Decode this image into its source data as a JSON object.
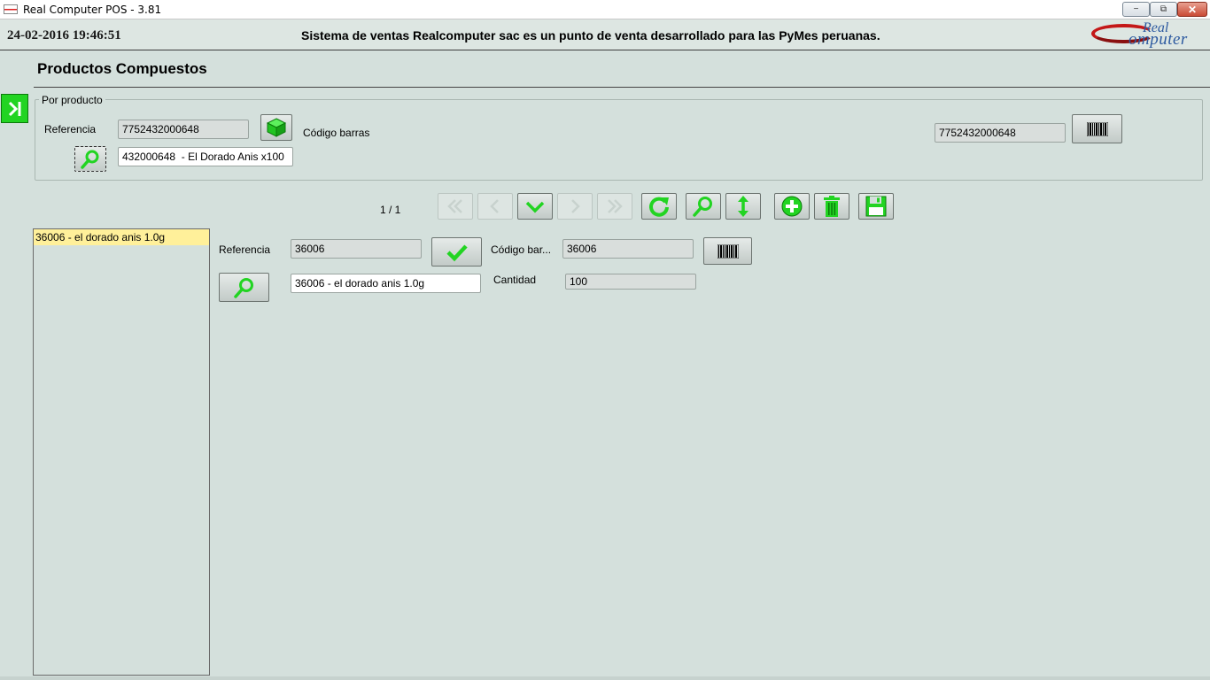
{
  "window": {
    "title": "Real Computer POS - 3.81",
    "minimize": "−",
    "maximize": "⧉",
    "close": "✕"
  },
  "header": {
    "datetime": "24-02-2016 19:46:51",
    "tagline": "Sistema de ventas Realcomputer sac es un punto de venta desarrollado para las PyMes peruanas.",
    "logo_text_top": "Real",
    "logo_text_bottom": "omputer"
  },
  "page": {
    "title": "Productos Compuestos"
  },
  "filter": {
    "legend": "Por producto",
    "referencia_label": "Referencia",
    "referencia_value": "7752432000648",
    "codigo_label": "Código barras",
    "codigo_value": "7752432000648",
    "producto_value": "432000648  - El Dorado Anis x100"
  },
  "pager": {
    "text": "1 / 1"
  },
  "list": {
    "items": [
      "36006 - el dorado anis 1.0g"
    ]
  },
  "detail": {
    "referencia_label": "Referencia",
    "referencia_value": "36006",
    "codigo_label": "Código bar...",
    "codigo_value": "36006",
    "producto_value": "36006 - el dorado anis 1.0g",
    "cantidad_label": "Cantidad",
    "cantidad_value": "100"
  },
  "colors": {
    "accent_green": "#22d422",
    "highlight_yellow": "#fff09a",
    "background": "#d4e0dc"
  },
  "icons": {
    "side": "collapse-panel-icon",
    "product": "box-icon",
    "search": "magnifier-icon",
    "barcode": "barcode-icon",
    "first": "double-chevron-left-icon",
    "prev": "chevron-left-icon",
    "select": "chevron-down-icon",
    "next": "chevron-right-icon",
    "last": "double-chevron-right-icon",
    "refresh": "refresh-icon",
    "find": "magnifier-icon",
    "sort": "vertical-arrows-icon",
    "add": "plus-circle-icon",
    "delete": "trash-icon",
    "save": "floppy-icon",
    "confirm": "checkmark-icon"
  }
}
